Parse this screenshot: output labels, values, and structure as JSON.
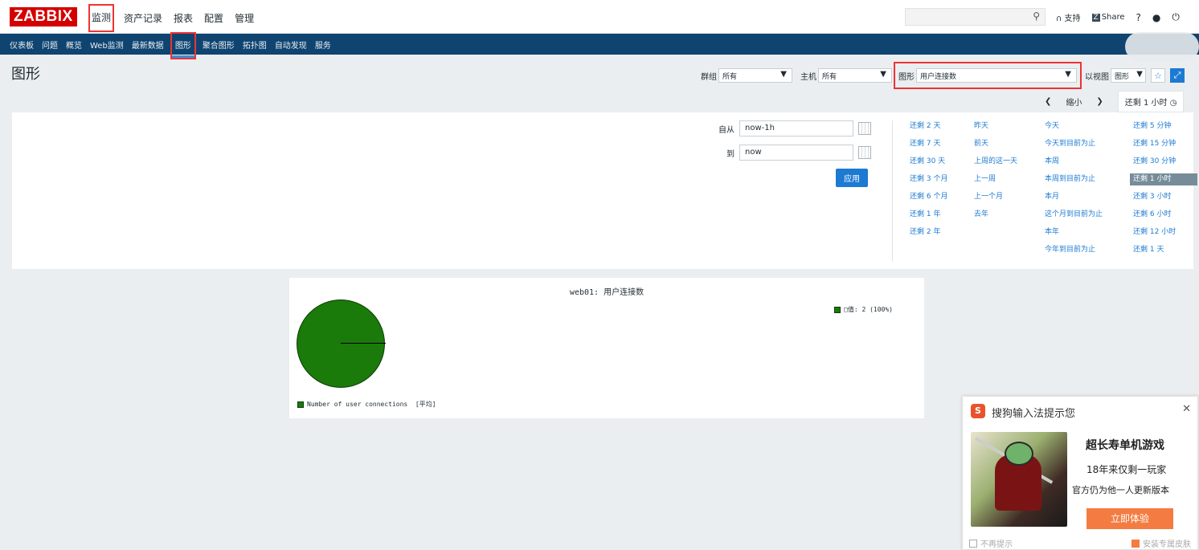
{
  "top": {
    "logo": "ZABBIX",
    "menu": [
      "监测",
      "资产记录",
      "报表",
      "配置",
      "管理"
    ],
    "support": "支持",
    "share": "Share",
    "help": "?"
  },
  "subnav": [
    "仪表板",
    "问题",
    "概览",
    "Web监测",
    "最新数据",
    "图形",
    "聚合图形",
    "拓扑图",
    "自动发现",
    "服务"
  ],
  "page": {
    "title": "图形"
  },
  "filters": {
    "group_label": "群组",
    "group_value": "所有",
    "host_label": "主机",
    "host_value": "所有",
    "graph_label": "图形",
    "graph_value": "用户连接数",
    "view_label": "以视图",
    "view_value": "图形"
  },
  "timenav": {
    "zoom_out": "缩小",
    "current": "还剩 1 小时"
  },
  "time_filter": {
    "from_label": "自从",
    "from_value": "now-1h",
    "to_label": "到",
    "to_value": "now",
    "apply": "应用"
  },
  "quick_ranges": [
    [
      "还剩 2 天",
      "昨天",
      "今天",
      "还剩 5 分钟"
    ],
    [
      "还剩 7 天",
      "前天",
      "今天到目前为止",
      "还剩 15 分钟"
    ],
    [
      "还剩 30 天",
      "上周的这一天",
      "本周",
      "还剩 30 分钟"
    ],
    [
      "还剩 3 个月",
      "上一周",
      "本周到目前为止",
      "还剩 1 小时"
    ],
    [
      "还剩 6 个月",
      "上一个月",
      "本月",
      "还剩 3 小时"
    ],
    [
      "还剩 1 年",
      "去年",
      "这个月到目前为止",
      "还剩 6 小时"
    ],
    [
      "还剩 2 年",
      "",
      "本年",
      "还剩 12 小时"
    ],
    [
      "",
      "",
      "今年到目前为止",
      "还剩 1 天"
    ]
  ],
  "graph": {
    "title": "web01: 用户连接数",
    "legend_top": "□值: 2 (100%)",
    "legend_bottom": "Number of user connections  [平均]",
    "color": "#1a7a0a"
  },
  "popup": {
    "title": "搜狗输入法提示您",
    "headline": "超长寿单机游戏",
    "line1": "18年来仅剩一玩家",
    "line2": "官方仍为他一人更新版本",
    "button": "立即体验",
    "no_remind": "不再提示",
    "skin": "安装专属皮肤"
  }
}
